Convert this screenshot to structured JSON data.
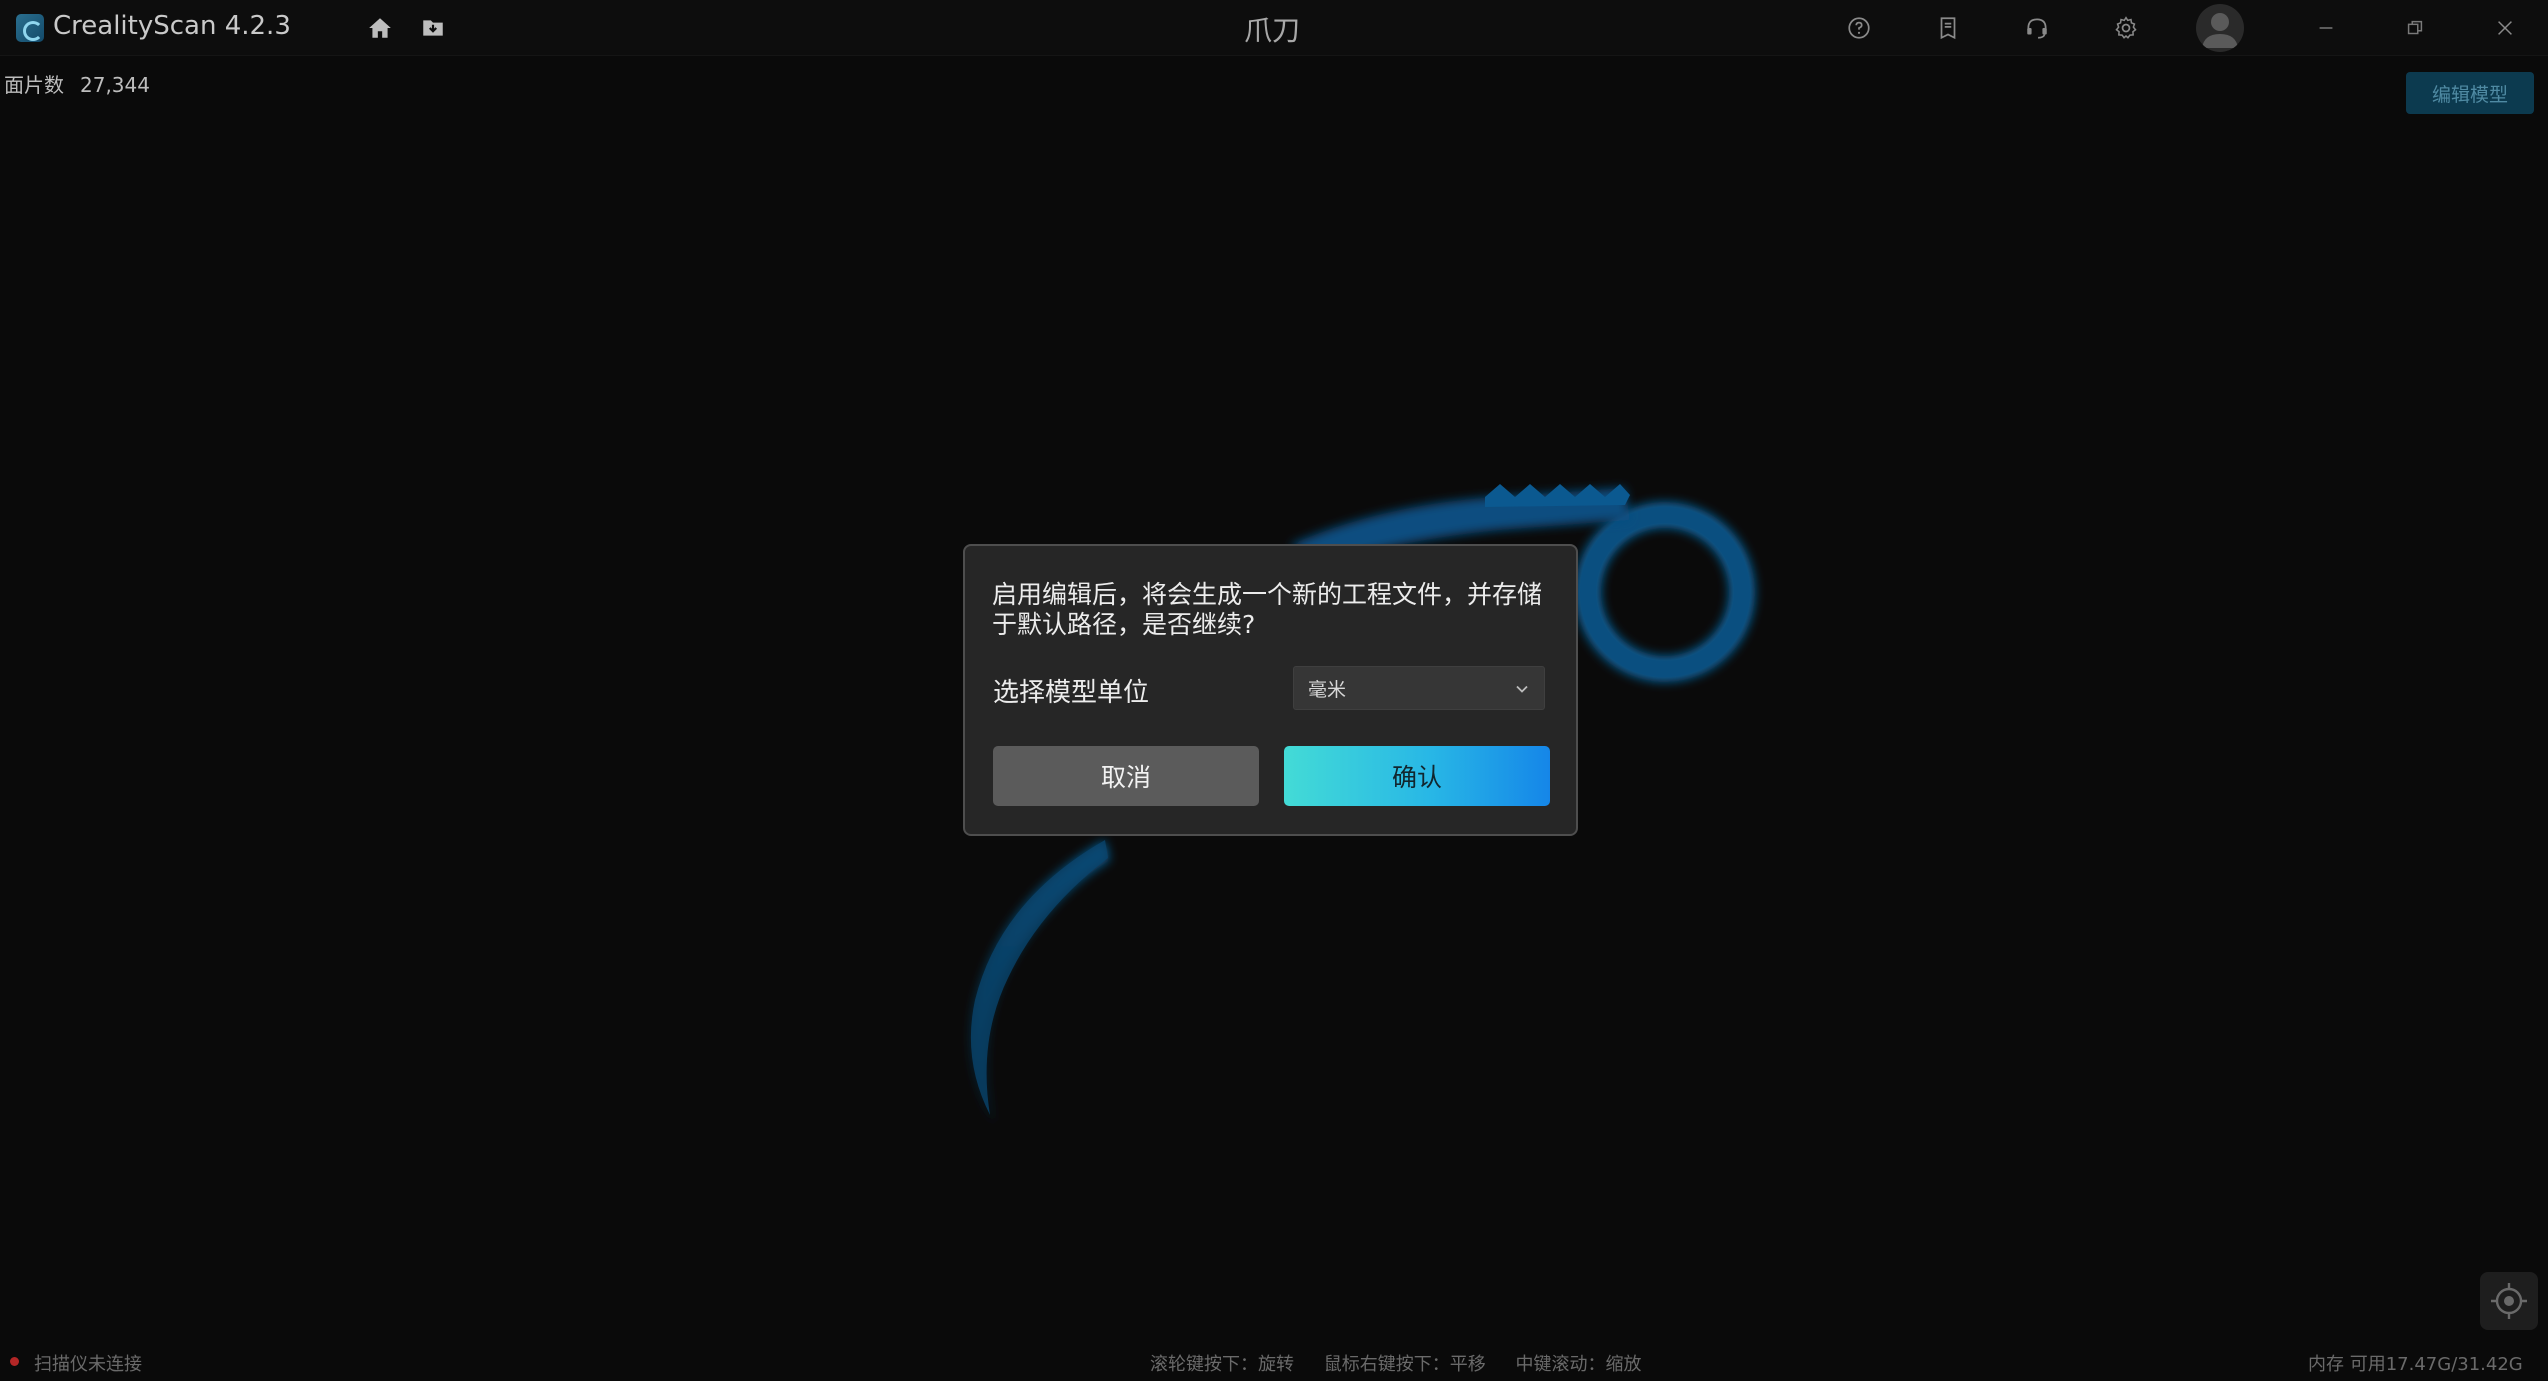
{
  "app": {
    "title": "CrealityScan 4.2.3",
    "project_title": "爪刀"
  },
  "toolbar": {
    "icons": [
      "home-icon",
      "folder-icon"
    ],
    "right_icons": [
      "help-icon",
      "document-icon",
      "headset-icon",
      "gear-icon",
      "avatar-icon"
    ],
    "window_controls": [
      "minimize-icon",
      "restore-icon",
      "close-icon"
    ]
  },
  "info": {
    "face_count_label": "面片数",
    "face_count_value": "27,344",
    "edit_model_label": "编辑模型"
  },
  "dialog": {
    "message": "启用编辑后，将会生成一个新的工程文件，并存储于默认路径，是否继续?",
    "unit_label": "选择模型单位",
    "unit_value": "毫米",
    "cancel_label": "取消",
    "confirm_label": "确认"
  },
  "status": {
    "scanner": "扫描仪未连接",
    "hint_rotate": "滚轮键按下：旋转",
    "hint_pan": "鼠标右键按下：平移",
    "hint_zoom": "中键滚动：缩放",
    "memory": "内存 可用17.47G/31.42G"
  },
  "colors": {
    "accent_gradient_start": "#43dbd6",
    "accent_gradient_end": "#1586e8",
    "model_glow": "#0a74b8",
    "status_disconnected": "#b32626"
  }
}
